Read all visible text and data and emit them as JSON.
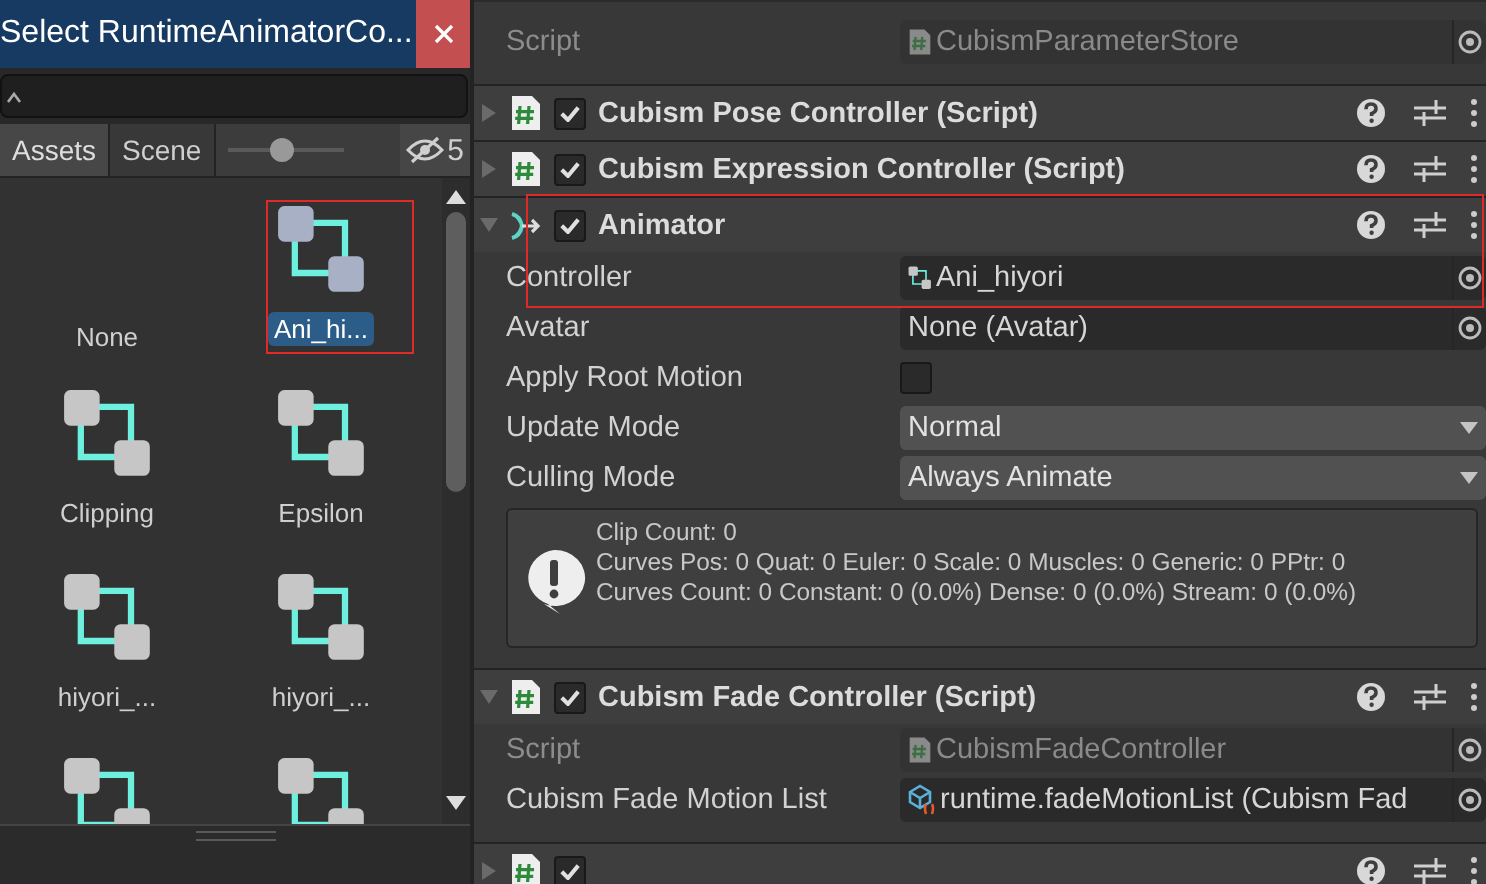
{
  "picker": {
    "title": "Select RuntimeAnimatorCo...",
    "tabs": [
      {
        "label": "Assets",
        "selected": true
      },
      {
        "label": "Scene",
        "selected": false
      }
    ],
    "zoom": {
      "level": 0.47
    },
    "hidden_count": "5",
    "items": [
      {
        "label": "None",
        "kind": "none",
        "selected": false
      },
      {
        "label": "Ani_hi...",
        "kind": "controller",
        "selected": true
      },
      {
        "label": "Clipping",
        "kind": "controller",
        "selected": false
      },
      {
        "label": "Epsilon",
        "kind": "controller",
        "selected": false
      },
      {
        "label": "hiyori_...",
        "kind": "controller",
        "selected": false
      },
      {
        "label": "hiyori_...",
        "kind": "controller",
        "selected": false
      },
      {
        "kind": "controller",
        "selected": false
      },
      {
        "kind": "controller",
        "selected": false
      }
    ]
  },
  "inspector": {
    "top_properties": [
      {
        "label": "Script",
        "kind": "script",
        "value": "CubismParameterStore",
        "disabled": true
      }
    ],
    "components": [
      {
        "title": "Cubism Pose Controller (Script)",
        "kind": "script",
        "enabled": true,
        "expanded": false
      },
      {
        "title": "Cubism Expression Controller (Script)",
        "kind": "script",
        "enabled": true,
        "expanded": false
      },
      {
        "title": "Animator",
        "kind": "animator",
        "enabled": true,
        "expanded": true,
        "properties": [
          {
            "label": "Controller",
            "kind": "controller",
            "value": "Ani_hiyori",
            "disabled": false
          },
          {
            "label": "Avatar",
            "kind": "object",
            "value": "None (Avatar)",
            "disabled": false
          },
          {
            "label": "Apply Root Motion",
            "kind": "checkbox",
            "checked": false,
            "disabled": false
          },
          {
            "label": "Update Mode",
            "kind": "dropdown",
            "value": "Normal",
            "disabled": false
          },
          {
            "label": "Culling Mode",
            "kind": "dropdown",
            "value": "Always Animate",
            "disabled": false
          }
        ],
        "info": [
          "Clip Count: 0",
          "Curves Pos: 0 Quat: 0 Euler: 0 Scale: 0 Muscles: 0 Generic: 0 PPtr: 0",
          "Curves Count: 0 Constant: 0 (0.0%) Dense: 0 (0.0%) Stream: 0 (0.0%)"
        ]
      },
      {
        "title": "Cubism Fade Controller (Script)",
        "kind": "script",
        "enabled": true,
        "expanded": true,
        "properties": [
          {
            "label": "Script",
            "kind": "script",
            "value": "CubismFadeController",
            "disabled": true
          },
          {
            "label": "Cubism Fade Motion List",
            "kind": "asset",
            "value": "runtime.fadeMotionList (Cubism Fad",
            "disabled": false
          }
        ]
      },
      {
        "kind": "script",
        "enabled": true,
        "expanded": false
      }
    ]
  }
}
